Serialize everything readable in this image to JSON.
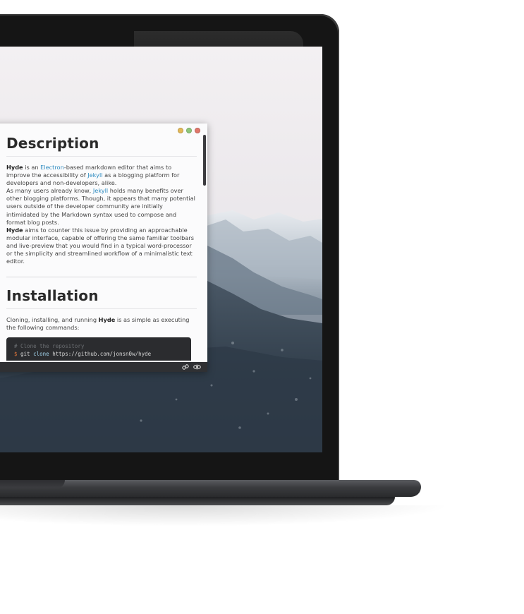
{
  "window": {
    "traffic_colors": [
      "#e2b857",
      "#8fc77a",
      "#e0776a"
    ]
  },
  "document": {
    "description": {
      "heading": "Description",
      "p1": {
        "hyde": "Hyde",
        "t1": " is an ",
        "electron": "Electron",
        "t2": "-based markdown editor that aims to improve the accessibility of ",
        "jekyll": "Jekyll",
        "t3": " as a blogging platform for developers and non-developers, alike."
      },
      "p2": {
        "t1": "As many users already know, ",
        "jekyll": "Jekyll",
        "t2": " holds many benefits over other blogging platforms. Though, it appears that many potential users outside of the developer community are initially intimidated by the Markdown syntax used to compose and format blog posts."
      },
      "p3": {
        "hyde": "Hyde",
        "t1": " aims to counter this issue by providing an approachable modular interface, capable of offering the same familiar toolbars and live-preview that you would find in a typical word-processor or the simplicity and streamlined workflow of a minimalistic text editor."
      }
    },
    "installation": {
      "heading": "Installation",
      "p1": {
        "t1": "Cloning, installing, and running ",
        "hyde": "Hyde",
        "t2": " is as simple as executing the following commands:"
      },
      "code": {
        "comment": "# Clone the repository",
        "prompt": "$",
        "cmd_git": "git",
        "cmd_clone": "clone",
        "cmd_url": "https://github.com/jonsn0w/hyde"
      }
    }
  },
  "statusbar": {
    "icons": [
      "link-icon",
      "eye-icon"
    ]
  },
  "colors": {
    "link": "#2e8bc0",
    "app_bg": "#fbfbfc",
    "statusbar_bg": "#2f3033",
    "code_bg": "#2b2c2f"
  }
}
